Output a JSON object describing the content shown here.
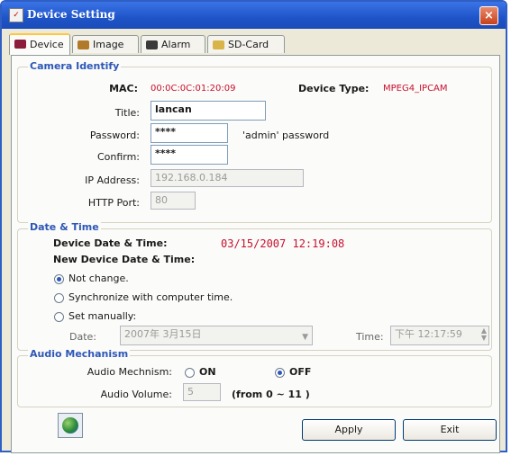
{
  "window": {
    "title": "Device Setting",
    "close_symbol": "×"
  },
  "tabs": [
    {
      "label": "Device",
      "active": true
    },
    {
      "label": "Image",
      "active": false
    },
    {
      "label": "Alarm",
      "active": false
    },
    {
      "label": "SD-Card",
      "active": false
    }
  ],
  "camera": {
    "group_title": "Camera Identify",
    "mac_label": "MAC:",
    "mac_value": "00:0C:0C:01:20:09",
    "device_type_label": "Device Type:",
    "device_type_value": "MPEG4_IPCAM",
    "title_label": "Title:",
    "title_value": "lancan",
    "password_label": "Password:",
    "password_value": "****",
    "password_hint": "'admin' password",
    "confirm_label": "Confirm:",
    "confirm_value": "****",
    "ip_label": "IP Address:",
    "ip_value": "192.168.0.184",
    "http_label": "HTTP Port:",
    "http_value": "80"
  },
  "datetime": {
    "group_title": "Date & Time",
    "device_dt_label": "Device Date & Time:",
    "device_dt_value": "03/15/2007 12:19:08",
    "new_dt_label": "New Device Date & Time:",
    "options": [
      {
        "label": "Not change.",
        "selected": true
      },
      {
        "label": "Synchronize with computer time.",
        "selected": false
      },
      {
        "label": "Set manually:",
        "selected": false
      }
    ],
    "date_label": "Date:",
    "date_value": "2007年 3月15日",
    "time_label": "Time:",
    "time_value": "下午 12:17:59"
  },
  "audio": {
    "group_title": "Audio Mechanism",
    "mechanism_label": "Audio Mechnism:",
    "on_label": "ON",
    "off_label": "OFF",
    "selected": "OFF",
    "volume_label": "Audio Volume:",
    "volume_value": "5",
    "volume_range": "(from 0 ~ 11 )"
  },
  "buttons": {
    "apply": "Apply",
    "exit": "Exit"
  },
  "colors": {
    "title_bar": "#1e54c8",
    "accent_text": "#2d57b8",
    "value_red": "#c8102e"
  }
}
